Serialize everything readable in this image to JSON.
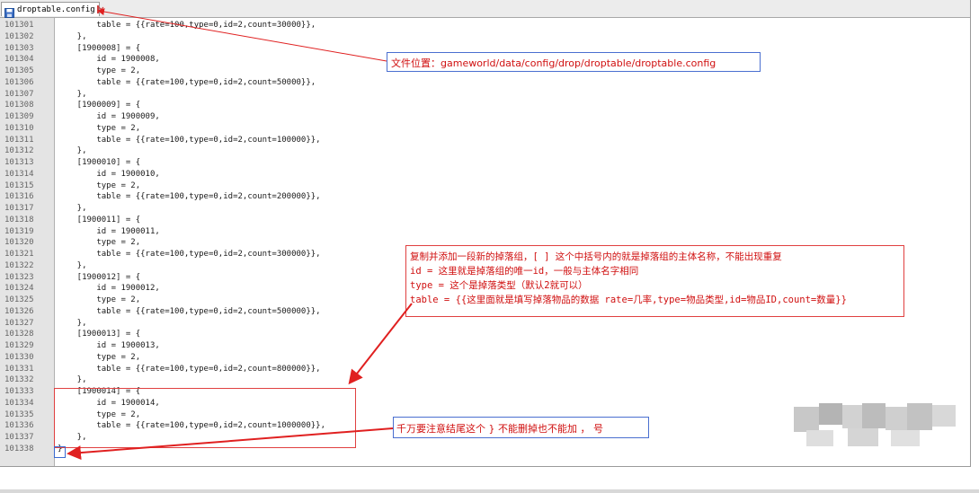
{
  "tab": {
    "title": "droptable.config",
    "icon": "save-icon"
  },
  "lines": [
    {
      "n": "101301",
      "t": "        table = {{rate=100,type=0,id=2,count=30000}},"
    },
    {
      "n": "101302",
      "t": "    },"
    },
    {
      "n": "101303",
      "t": "    [1900008] = {"
    },
    {
      "n": "101304",
      "t": "        id = 1900008,"
    },
    {
      "n": "101305",
      "t": "        type = 2,"
    },
    {
      "n": "101306",
      "t": "        table = {{rate=100,type=0,id=2,count=50000}},"
    },
    {
      "n": "101307",
      "t": "    },"
    },
    {
      "n": "101308",
      "t": "    [1900009] = {"
    },
    {
      "n": "101309",
      "t": "        id = 1900009,"
    },
    {
      "n": "101310",
      "t": "        type = 2,"
    },
    {
      "n": "101311",
      "t": "        table = {{rate=100,type=0,id=2,count=100000}},"
    },
    {
      "n": "101312",
      "t": "    },"
    },
    {
      "n": "101313",
      "t": "    [1900010] = {"
    },
    {
      "n": "101314",
      "t": "        id = 1900010,"
    },
    {
      "n": "101315",
      "t": "        type = 2,"
    },
    {
      "n": "101316",
      "t": "        table = {{rate=100,type=0,id=2,count=200000}},"
    },
    {
      "n": "101317",
      "t": "    },"
    },
    {
      "n": "101318",
      "t": "    [1900011] = {"
    },
    {
      "n": "101319",
      "t": "        id = 1900011,"
    },
    {
      "n": "101320",
      "t": "        type = 2,"
    },
    {
      "n": "101321",
      "t": "        table = {{rate=100,type=0,id=2,count=300000}},"
    },
    {
      "n": "101322",
      "t": "    },"
    },
    {
      "n": "101323",
      "t": "    [1900012] = {"
    },
    {
      "n": "101324",
      "t": "        id = 1900012,"
    },
    {
      "n": "101325",
      "t": "        type = 2,"
    },
    {
      "n": "101326",
      "t": "        table = {{rate=100,type=0,id=2,count=500000}},"
    },
    {
      "n": "101327",
      "t": "    },"
    },
    {
      "n": "101328",
      "t": "    [1900013] = {"
    },
    {
      "n": "101329",
      "t": "        id = 1900013,"
    },
    {
      "n": "101330",
      "t": "        type = 2,"
    },
    {
      "n": "101331",
      "t": "        table = {{rate=100,type=0,id=2,count=800000}},"
    },
    {
      "n": "101332",
      "t": "    },"
    },
    {
      "n": "101333",
      "t": "    [1900014] = {"
    },
    {
      "n": "101334",
      "t": "        id = 1900014,"
    },
    {
      "n": "101335",
      "t": "        type = 2,"
    },
    {
      "n": "101336",
      "t": "        table = {{rate=100,type=0,id=2,count=1000000}},"
    },
    {
      "n": "101337",
      "t": "    },"
    },
    {
      "n": "101338",
      "t": "}"
    }
  ],
  "annotations": {
    "path": "文件位置：gameworld/data/config/drop/droptable/droptable.config",
    "info": [
      "复制并添加一段新的掉落组，[ ] 这个中括号内的就是掉落组的主体名称，不能出现重复",
      "id = 这里就是掉落组的唯一id，一般与主体名字相同",
      "type = 这个是掉落类型（默认2就可以）",
      "table = {{这里面就是填写掉落物品的数据 rate=几率,type=物品类型,id=物品ID,count=数量}}"
    ],
    "warning": "千万要注意结尾这个 } 不能删掉也不能加 ， 号"
  },
  "colors": {
    "annotation_red": "#d01010",
    "box_red": "#e04040",
    "box_blue": "#4a6fd0"
  }
}
